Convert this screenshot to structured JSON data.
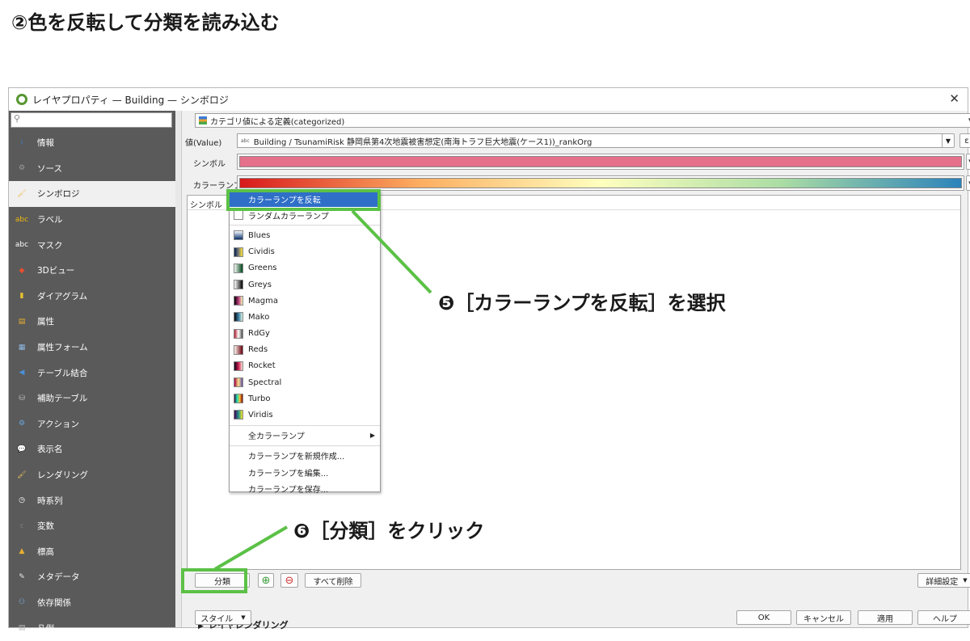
{
  "page": {
    "heading": "②色を反転して分類を読み込む"
  },
  "window": {
    "title": "レイヤプロパティ — Building — シンボロジ",
    "close": "✕",
    "search_icon": "⚲"
  },
  "sidebar": {
    "items": [
      {
        "label": "情報",
        "icon": "info-icon",
        "glyph": "i",
        "color": "#3d7fc8"
      },
      {
        "label": "ソース",
        "icon": "source-icon",
        "glyph": "⚙",
        "color": "#9c9c9c"
      },
      {
        "label": "シンボロジ",
        "icon": "symbology-icon",
        "glyph": "🖌",
        "color": "#f0c060"
      },
      {
        "label": "ラベル",
        "icon": "label-icon",
        "glyph": "abc",
        "color": "#f2b90d"
      },
      {
        "label": "マスク",
        "icon": "mask-icon",
        "glyph": "abc",
        "color": "#ffffff"
      },
      {
        "label": "3Dビュー",
        "icon": "3d-view-icon",
        "glyph": "◆",
        "color": "#e84f2e"
      },
      {
        "label": "ダイアグラム",
        "icon": "diagram-icon",
        "glyph": "▮",
        "color": "#e8c030"
      },
      {
        "label": "属性",
        "icon": "attributes-icon",
        "glyph": "▤",
        "color": "#e8b030"
      },
      {
        "label": "属性フォーム",
        "icon": "attribute-form-icon",
        "glyph": "▦",
        "color": "#8fb8e0"
      },
      {
        "label": "テーブル結合",
        "icon": "join-icon",
        "glyph": "◀",
        "color": "#4a90d9"
      },
      {
        "label": "補助テーブル",
        "icon": "auxiliary-storage-icon",
        "glyph": "⛁",
        "color": "#c0c0c0"
      },
      {
        "label": "アクション",
        "icon": "actions-icon",
        "glyph": "⚙",
        "color": "#6aa8e0"
      },
      {
        "label": "表示名",
        "icon": "display-icon",
        "glyph": "💬",
        "color": "#f2d04a"
      },
      {
        "label": "レンダリング",
        "icon": "rendering-icon",
        "glyph": "🖌",
        "color": "#f0c060"
      },
      {
        "label": "時系列",
        "icon": "temporal-icon",
        "glyph": "◷",
        "color": "#ffffff"
      },
      {
        "label": "変数",
        "icon": "variables-icon",
        "glyph": "ε",
        "color": "#7a7a7a"
      },
      {
        "label": "標高",
        "icon": "elevation-icon",
        "glyph": "▲",
        "color": "#e8b030"
      },
      {
        "label": "メタデータ",
        "icon": "metadata-icon",
        "glyph": "✎",
        "color": "#e8e8e8"
      },
      {
        "label": "依存関係",
        "icon": "dependencies-icon",
        "glyph": "⚇",
        "color": "#7ab0e0"
      },
      {
        "label": "凡例",
        "icon": "legend-icon",
        "glyph": "▤",
        "color": "#c0c0c0"
      }
    ],
    "active_index": 2
  },
  "renderer": {
    "selected": "カテゴリ値による定義(categorized)"
  },
  "value": {
    "label": "値(Value)",
    "field": "Building / TsunamiRisk 静岡県第4次地震被害想定(南海トラフ巨大地震(ケース1))_rankOrg",
    "expr_button": "ε"
  },
  "symbol": {
    "label": "シンボル",
    "color": "#e5708a"
  },
  "colorramp": {
    "label": "カラーランプ"
  },
  "panel": {
    "header": "シンボル"
  },
  "menu": {
    "items": [
      {
        "label": "カラーランプを反転",
        "highlight": true,
        "swatch": ""
      },
      {
        "label": "ランダムカラーランプ",
        "swatch": "empty"
      },
      {
        "sep": true
      },
      {
        "label": "Blues",
        "swatch": "linear-gradient(#f7fbff,#08306b)"
      },
      {
        "label": "Cividis",
        "swatch": "linear-gradient(90deg,#00224e,#7c7b78,#fee838)"
      },
      {
        "label": "Greens",
        "swatch": "linear-gradient(90deg,#f7fcf5,#00441b)"
      },
      {
        "label": "Greys",
        "swatch": "linear-gradient(90deg,#ffffff,#000000)"
      },
      {
        "label": "Magma",
        "swatch": "linear-gradient(90deg,#000004,#b73779,#fcfdbf)"
      },
      {
        "label": "Mako",
        "swatch": "linear-gradient(90deg,#0b0405,#357ba2,#def5e5)"
      },
      {
        "label": "RdGy",
        "swatch": "linear-gradient(90deg,#b2182b,#ffffff,#4d4d4d)"
      },
      {
        "label": "Reds",
        "swatch": "linear-gradient(90deg,#fff5f0,#67000d)"
      },
      {
        "label": "Rocket",
        "swatch": "linear-gradient(90deg,#03051a,#cb1b4f,#faebdd)"
      },
      {
        "label": "Spectral",
        "swatch": "linear-gradient(90deg,#9e0142,#fee08b,#5e4fa2)"
      },
      {
        "label": "Turbo",
        "swatch": "linear-gradient(90deg,#30123b,#1ae4b6,#fabb39,#7a0403)"
      },
      {
        "label": "Viridis",
        "swatch": "linear-gradient(90deg,#440154,#21918c,#fde725)"
      },
      {
        "sep": true
      },
      {
        "label": "全カラーランプ",
        "submenu": true,
        "swatch": ""
      },
      {
        "sep": true
      },
      {
        "label": "カラーランプを新規作成...",
        "swatch": ""
      },
      {
        "label": "カラーランプを編集...",
        "swatch": ""
      },
      {
        "label": "カラーランプを保存...",
        "swatch": ""
      }
    ]
  },
  "buttons": {
    "classify": "分類",
    "add_icon": "⊕",
    "remove_icon": "⊖",
    "delete_all": "すべて削除",
    "advanced": "詳細設定",
    "layer_rendering": "レイヤレンダリング",
    "style": "スタイル",
    "ok": "OK",
    "cancel": "キャンセル",
    "apply": "適用",
    "help": "ヘルプ"
  },
  "annotations": {
    "step5": "❺［カラーランプを反転］を選択",
    "step6": "❻［分類］をクリック"
  },
  "colors": {
    "accent_green": "#5bc146",
    "highlight_blue": "#2f6fc8"
  }
}
